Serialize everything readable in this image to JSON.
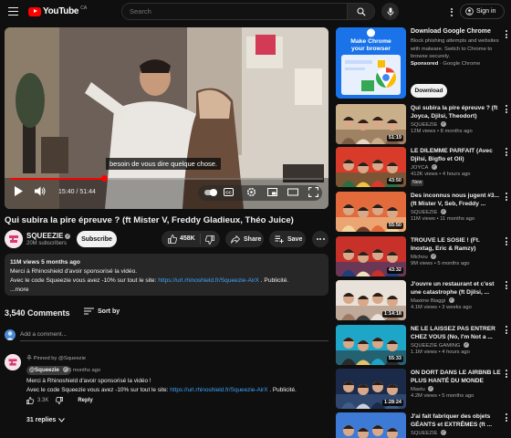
{
  "header": {
    "logo_text": "YouTube",
    "logo_region": "CA",
    "search_placeholder": "Search",
    "signin_label": "Sign in"
  },
  "player": {
    "caption": "besoin de vous dire quelque chose.",
    "current_time": "15:40",
    "duration": "51:44",
    "progress_fraction": 0.303
  },
  "video": {
    "title": "Qui subira la pire épreuve ? (ft Mister V, Freddy Gladieux, Théo Juice)",
    "channel": "SQUEEZIE",
    "subscribers": "20M subscribers",
    "subscribe_label": "Subscribe",
    "likes": "458K",
    "share_label": "Share",
    "save_label": "Save"
  },
  "description": {
    "meta": "11M views  5 months ago",
    "line1": "Merci à Rhinoshield d'avoir sponsorisé la vidéo.",
    "line2_prefix": "Avec le code Squeezie vous avez -10% sur tout le site: ",
    "line2_link": "https://url.rhinoshield.fr/Squeezie-AirX",
    "line2_suffix": " . Publicité.",
    "more": "...more"
  },
  "comments": {
    "count": "3,540 Comments",
    "sort_label": "Sort by",
    "add_placeholder": "Add a comment...",
    "pinned_label": "Pinned by @Squeezie",
    "author": "@Squeezie",
    "time": "5 months ago",
    "line1": "Merci à Rhinoshield d'avoir sponsorisé la vidéo !",
    "line2_prefix": "Avec le code Squeezie vous avez -10% sur tout le site: ",
    "line2_link": "https://url.rhinoshield.fr/Squeezie-AirX",
    "line2_suffix": " . Publicité.",
    "likes": "3.3K",
    "reply_label": "Reply",
    "replies_label": "31 replies"
  },
  "ad": {
    "thumb_text": "Make Chrome your browser",
    "title": "Download Google Chrome",
    "body": "Block phishing attempts and websites with malware. Switch to Chrome to browse securely.",
    "sponsored": "Sponsored",
    "advertiser": " · Google Chrome",
    "download_label": "Download"
  },
  "recommendations": [
    {
      "title": "Qui subira la pire épreuve ? (ft Joyca, Djilsi, Theodort)",
      "channel": "SQUEEZIE",
      "meta": "12M views • 8 months ago",
      "duration": "51:19",
      "new": "",
      "colors": [
        "#c9b08a",
        "#7b5d46",
        "#e8d7c3"
      ]
    },
    {
      "title": "LE DILEMME PARFAIT (Avec Djilsi, Bigflo et Oli)",
      "channel": "JOYCA",
      "meta": "412K views • 4 hours ago",
      "duration": "43:50",
      "new": "New",
      "colors": [
        "#d93b2b",
        "#2d6e3e",
        "#f0c341"
      ]
    },
    {
      "title": "Des inconnus nous jugent #3... (ft Mister V, Seb, Freddy ...",
      "channel": "SQUEEZIE",
      "meta": "11M views • 11 months ago",
      "duration": "55:50",
      "new": "",
      "colors": [
        "#e36a3a",
        "#f3d5a0",
        "#6b3a2a"
      ]
    },
    {
      "title": "TROUVE LE SOSIE ! (Ft. Inoxtag, Eric & Ramzy)",
      "channel": "Michou",
      "meta": "9M views • 5 months ago",
      "duration": "43:32",
      "new": "",
      "colors": [
        "#c8302a",
        "#1f3e7a",
        "#f0e0c0"
      ]
    },
    {
      "title": "J'ouvre un restaurant et c'est une catastrophe (ft Djilsi, ...",
      "channel": "Maxime Biaggi",
      "meta": "4.1M views • 3 weeks ago",
      "duration": "1:14:18",
      "new": "",
      "colors": [
        "#e8e2da",
        "#9c7a62",
        "#3a3a3a"
      ]
    },
    {
      "title": "NE LE LAISSEZ PAS ENTRER CHEZ VOUS (No, I'm Not a ...",
      "channel": "SQUEEZIE GAMING",
      "meta": "1.1M views • 4 hours ago",
      "duration": "55:33",
      "new": "",
      "colors": [
        "#1ea6c9",
        "#2a2a2a",
        "#e6c36a"
      ]
    },
    {
      "title": "ON DORT DANS LE AIRBNB LE PLUS HANTÉ DU MONDE",
      "channel": "Mastu",
      "meta": "4.2M views • 5 months ago",
      "duration": "1:28:24",
      "new": "",
      "colors": [
        "#1c2a4a",
        "#3f5d8c",
        "#c9d3e0"
      ]
    },
    {
      "title": "J'ai fait fabriquer des objets GÉANTS et EXTRÊMES (ft ...",
      "channel": "SQUEEZIE",
      "meta": "",
      "duration": "",
      "new": "",
      "colors": [
        "#3c7ad6",
        "#d8b46a",
        "#f5f5f5"
      ]
    }
  ]
}
